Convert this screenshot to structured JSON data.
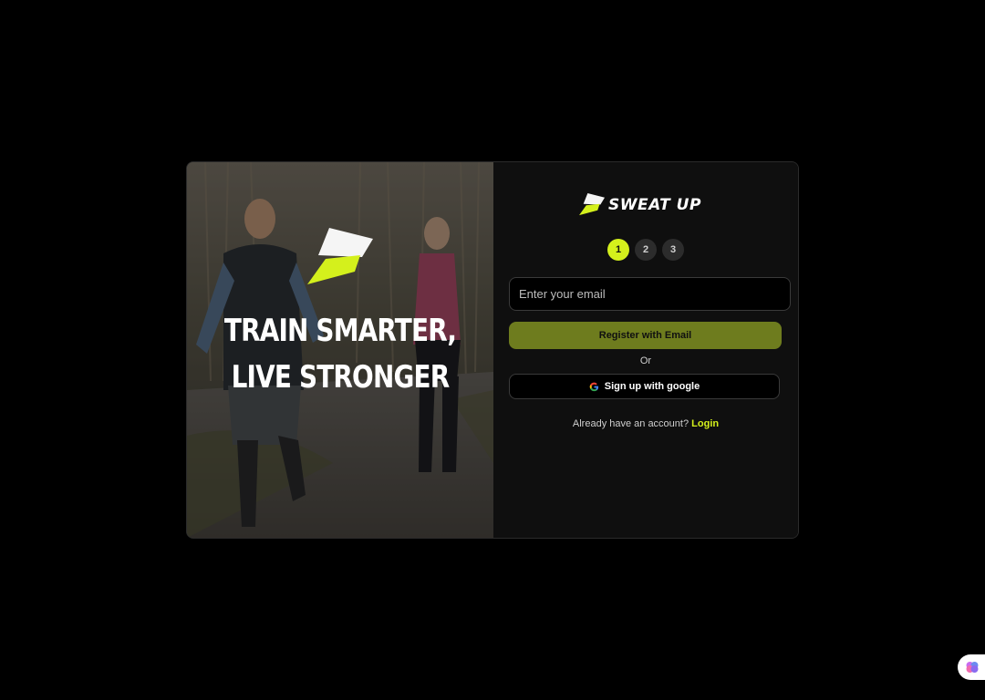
{
  "hero": {
    "headline_line1": "TRAIN SMARTER,",
    "headline_line2": "LIVE STRONGER",
    "logo_icon": "sweat-up-logo-mark"
  },
  "brand": {
    "name": "SWEAT UP",
    "logo_icon": "sweat-up-logo-mark"
  },
  "steps": {
    "items": [
      "1",
      "2",
      "3"
    ],
    "active": "1"
  },
  "form": {
    "email_placeholder": "Enter your email",
    "email_value": "",
    "register_label": "Register with Email",
    "or_label": "Or",
    "google_label": "Sign up with google",
    "google_icon": "google-icon",
    "account_prompt": "Already have an account?",
    "login_label": "Login"
  },
  "widget": {
    "icon": "brain-icon"
  },
  "colors": {
    "accent": "#d4f01c",
    "register_button": "#6e7c1e",
    "background": "#000000",
    "panel": "#0f0f0f"
  }
}
